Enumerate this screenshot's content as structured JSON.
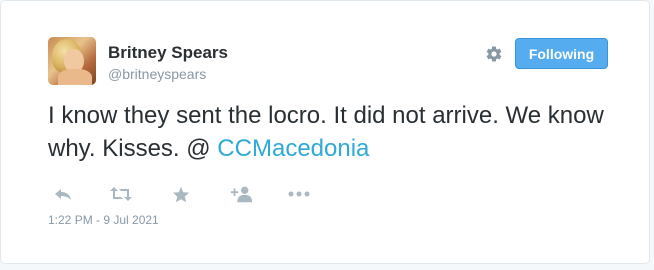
{
  "user": {
    "name": "Britney Spears",
    "handle": "@britneyspears"
  },
  "follow_button": {
    "label": "Following"
  },
  "tweet": {
    "text_before": "I know they sent the locro. It did not arrive. We know why. Kisses. ",
    "at_sign": "@",
    "link_text": " CCMacedonia",
    "timestamp": "1:22 PM - 9 Jul 2021"
  },
  "actions": [
    {
      "icon": "reply-icon"
    },
    {
      "icon": "retweet-icon"
    },
    {
      "icon": "favorite-star-icon"
    },
    {
      "icon": "follow-user-icon"
    },
    {
      "icon": "more-options-icon"
    }
  ],
  "colors": {
    "accent": "#55acee",
    "link": "#2fa9d6",
    "icon": "#aab8c2",
    "muted_text": "#8899a6",
    "text": "#292f33"
  }
}
